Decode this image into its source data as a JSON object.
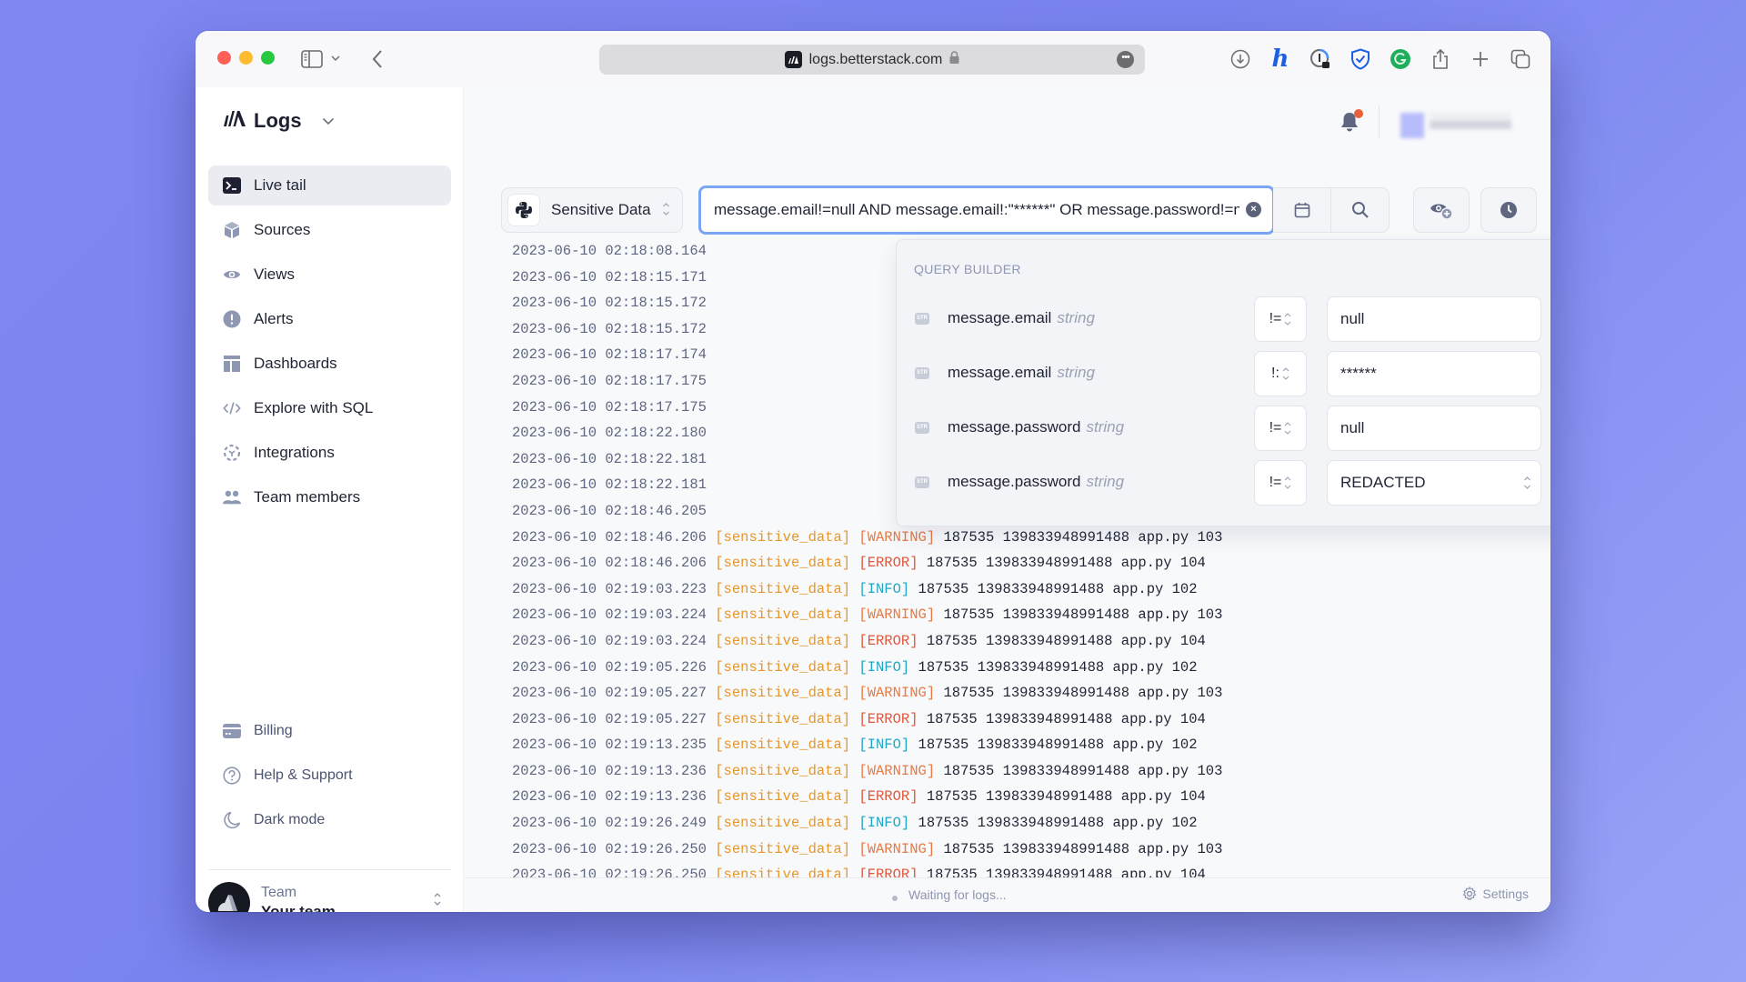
{
  "browser": {
    "url": "logs.betterstack.com",
    "more_label": "•••",
    "extensions": [
      "download-icon",
      "honey-icon",
      "password-manager-icon",
      "adguard-icon",
      "grammarly-icon",
      "share-icon",
      "new-tab-icon",
      "tabs-overview-icon"
    ]
  },
  "brand": {
    "name": "Logs"
  },
  "sidebar": {
    "items": [
      {
        "label": "Live tail",
        "icon": "terminal-icon",
        "active": true
      },
      {
        "label": "Sources",
        "icon": "cube-icon"
      },
      {
        "label": "Views",
        "icon": "eye-icon"
      },
      {
        "label": "Alerts",
        "icon": "alert-icon"
      },
      {
        "label": "Dashboards",
        "icon": "dashboard-icon"
      },
      {
        "label": "Explore with SQL",
        "icon": "code-icon"
      },
      {
        "label": "Integrations",
        "icon": "integrations-icon"
      },
      {
        "label": "Team members",
        "icon": "team-icon"
      }
    ],
    "bottom_items": [
      {
        "label": "Billing",
        "icon": "credit-card-icon"
      },
      {
        "label": "Help & Support",
        "icon": "help-icon"
      },
      {
        "label": "Dark mode",
        "icon": "moon-icon"
      }
    ],
    "team": {
      "label": "Team",
      "name": "Your team"
    }
  },
  "toolbar": {
    "source": "Sensitive Data",
    "query": "message.email!=null AND message.email!:\"******\" OR message.password!=null AND message.password!=REDACTED",
    "clear_label": "×"
  },
  "query_builder": {
    "title": "QUERY BUILDER",
    "type_badge": "STR",
    "rows": [
      {
        "field": "message.email",
        "type": "string",
        "operator": "!=",
        "value": "null"
      },
      {
        "field": "message.email",
        "type": "string",
        "operator": "!:",
        "value": "******"
      },
      {
        "field": "message.password",
        "type": "string",
        "operator": "!=",
        "value": "null"
      },
      {
        "field": "message.password",
        "type": "string",
        "operator": "!=",
        "value": "REDACTED"
      }
    ],
    "remove_label": "✕"
  },
  "logs": [
    {
      "ts": "2023-06-10 02:18:08.164",
      "src": "",
      "level": "",
      "msg": ""
    },
    {
      "ts": "2023-06-10 02:18:15.171",
      "src": "",
      "level": "",
      "msg": ""
    },
    {
      "ts": "2023-06-10 02:18:15.172",
      "src": "",
      "level": "",
      "msg": ""
    },
    {
      "ts": "2023-06-10 02:18:15.172",
      "src": "",
      "level": "",
      "msg": ""
    },
    {
      "ts": "2023-06-10 02:18:17.174",
      "src": "",
      "level": "",
      "msg": ""
    },
    {
      "ts": "2023-06-10 02:18:17.175",
      "src": "",
      "level": "",
      "msg": ""
    },
    {
      "ts": "2023-06-10 02:18:17.175",
      "src": "",
      "level": "",
      "msg": ""
    },
    {
      "ts": "2023-06-10 02:18:22.180",
      "src": "",
      "level": "",
      "msg": ""
    },
    {
      "ts": "2023-06-10 02:18:22.181",
      "src": "",
      "level": "",
      "msg": ""
    },
    {
      "ts": "2023-06-10 02:18:22.181",
      "src": "",
      "level": "",
      "msg": ""
    },
    {
      "ts": "2023-06-10 02:18:46.205",
      "src": "",
      "level": "",
      "msg": ""
    },
    {
      "ts": "2023-06-10 02:18:46.206",
      "src": "[sensitive_data]",
      "level": "WARNING",
      "msg": "187535 139833948991488 app.py 103"
    },
    {
      "ts": "2023-06-10 02:18:46.206",
      "src": "[sensitive_data]",
      "level": "ERROR",
      "msg": "187535 139833948991488 app.py 104"
    },
    {
      "ts": "2023-06-10 02:19:03.223",
      "src": "[sensitive_data]",
      "level": "INFO",
      "msg": "187535 139833948991488 app.py 102"
    },
    {
      "ts": "2023-06-10 02:19:03.224",
      "src": "[sensitive_data]",
      "level": "WARNING",
      "msg": "187535 139833948991488 app.py 103"
    },
    {
      "ts": "2023-06-10 02:19:03.224",
      "src": "[sensitive_data]",
      "level": "ERROR",
      "msg": "187535 139833948991488 app.py 104"
    },
    {
      "ts": "2023-06-10 02:19:05.226",
      "src": "[sensitive_data]",
      "level": "INFO",
      "msg": "187535 139833948991488 app.py 102"
    },
    {
      "ts": "2023-06-10 02:19:05.227",
      "src": "[sensitive_data]",
      "level": "WARNING",
      "msg": "187535 139833948991488 app.py 103"
    },
    {
      "ts": "2023-06-10 02:19:05.227",
      "src": "[sensitive_data]",
      "level": "ERROR",
      "msg": "187535 139833948991488 app.py 104"
    },
    {
      "ts": "2023-06-10 02:19:13.235",
      "src": "[sensitive_data]",
      "level": "INFO",
      "msg": "187535 139833948991488 app.py 102"
    },
    {
      "ts": "2023-06-10 02:19:13.236",
      "src": "[sensitive_data]",
      "level": "WARNING",
      "msg": "187535 139833948991488 app.py 103"
    },
    {
      "ts": "2023-06-10 02:19:13.236",
      "src": "[sensitive_data]",
      "level": "ERROR",
      "msg": "187535 139833948991488 app.py 104"
    },
    {
      "ts": "2023-06-10 02:19:26.249",
      "src": "[sensitive_data]",
      "level": "INFO",
      "msg": "187535 139833948991488 app.py 102"
    },
    {
      "ts": "2023-06-10 02:19:26.250",
      "src": "[sensitive_data]",
      "level": "WARNING",
      "msg": "187535 139833948991488 app.py 103"
    },
    {
      "ts": "2023-06-10 02:19:26.250",
      "src": "[sensitive_data]",
      "level": "ERROR",
      "msg": "187535 139833948991488 app.py 104"
    }
  ],
  "footer": {
    "status": "Waiting for logs...",
    "settings_label": "Settings"
  },
  "colors": {
    "accent": "#7aa6f5",
    "info": "#21a7c6",
    "warning": "#e77a45",
    "error": "#e0573c",
    "source_tag": "#e5972e",
    "notification_dot": "#e8613c"
  }
}
